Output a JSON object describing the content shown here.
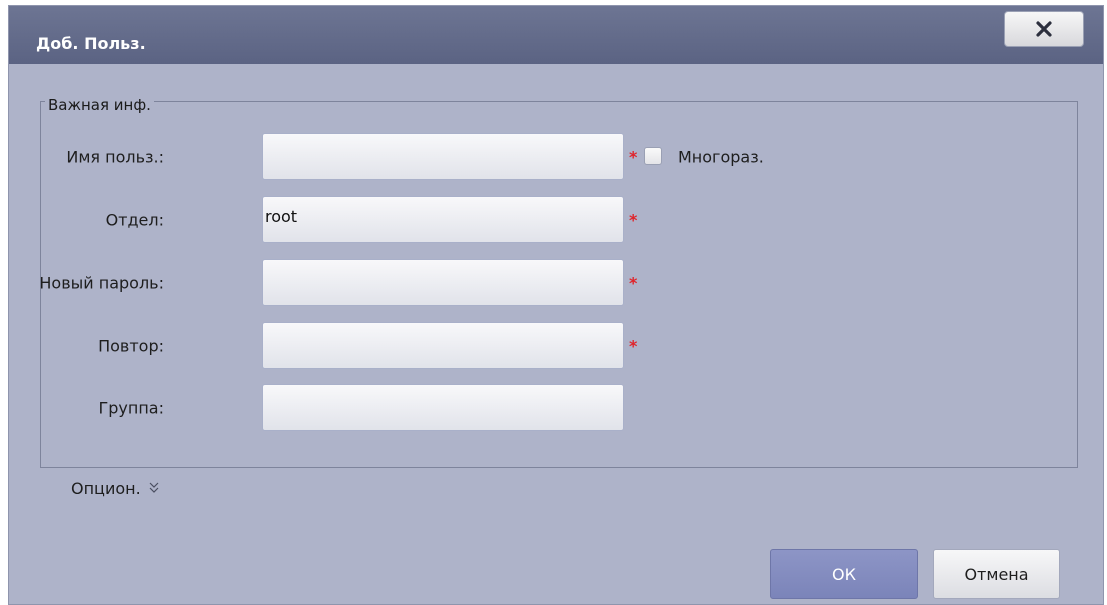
{
  "dialog": {
    "title": "Доб. Польз.",
    "close_icon": "close-icon"
  },
  "section": {
    "legend": "Важная инф."
  },
  "fields": {
    "username": {
      "label": "Имя польз.:",
      "value": "",
      "required": "*"
    },
    "department": {
      "label": "Отдел:",
      "value": "root",
      "required": "*"
    },
    "new_password": {
      "label": "Новый пароль:",
      "value": "",
      "required": "*"
    },
    "repeat": {
      "label": "Повтор:",
      "value": "",
      "required": "*"
    },
    "group": {
      "label": "Группа:",
      "value": ""
    }
  },
  "reusable": {
    "label": "Многораз.",
    "checked": false
  },
  "options_toggle": {
    "label": "Опцион.",
    "icon": "double-chevron-down-icon"
  },
  "buttons": {
    "ok": "ОК",
    "cancel": "Отмена"
  },
  "colors": {
    "titlebar": "#5f6787",
    "body": "#aeb3c9",
    "required": "#e0242a",
    "ok_button": "#848cbf"
  }
}
